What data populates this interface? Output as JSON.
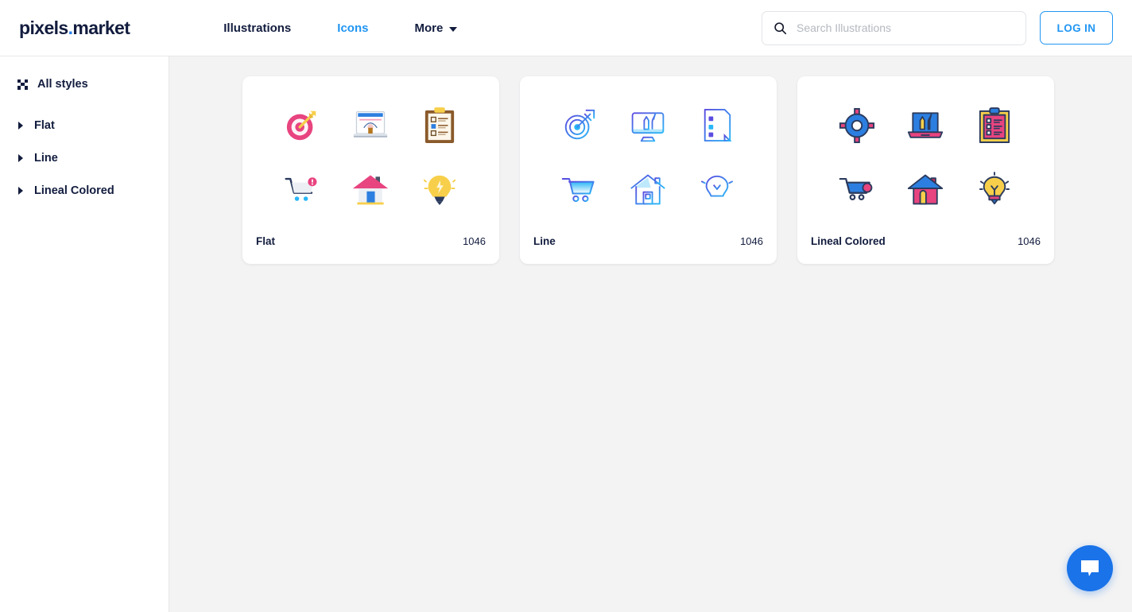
{
  "header": {
    "logo": {
      "text_main": "p",
      "text_i": "i",
      "text_rest": "xels",
      "dot": ".",
      "text_market": "market",
      "full": "pixels.market"
    },
    "nav": [
      {
        "label": "Illustrations",
        "active": false,
        "icon": null
      },
      {
        "label": "Icons",
        "active": true,
        "icon": null
      },
      {
        "label": "More",
        "active": false,
        "icon": "chevron-down-icon"
      }
    ],
    "search": {
      "placeholder": "Search Illustrations",
      "value": "",
      "icon": "search-icon"
    },
    "login_label": "LOG IN"
  },
  "sidebar": {
    "items": [
      {
        "label": "All styles",
        "icon": "grid-icon",
        "expandable": false
      },
      {
        "label": "Flat",
        "icon": "caret-right-icon",
        "expandable": true
      },
      {
        "label": "Line",
        "icon": "caret-right-icon",
        "expandable": true
      },
      {
        "label": "Lineal Colored",
        "icon": "caret-right-icon",
        "expandable": true
      }
    ]
  },
  "main": {
    "cards": [
      {
        "title": "Flat",
        "count": "1046",
        "style": "flat",
        "icons": [
          "target-arrow-icon",
          "laptop-design-icon",
          "clipboard-checklist-icon",
          "shopping-cart-badge-icon",
          "house-icon",
          "lightbulb-icon"
        ]
      },
      {
        "title": "Line",
        "count": "1046",
        "style": "line",
        "icons": [
          "target-arrow-icon",
          "monitor-design-icon",
          "checklist-document-icon",
          "shopping-cart-icon",
          "house-icon",
          "lightbulb-icon"
        ]
      },
      {
        "title": "Lineal Colored",
        "count": "1046",
        "style": "lineal-colored",
        "icons": [
          "target-icon",
          "laptop-tools-icon",
          "clipboard-checklist-icon",
          "shopping-cart-badge-icon",
          "house-icon",
          "lightbulb-icon"
        ]
      }
    ]
  },
  "chat": {
    "icon": "chat-bubble-icon",
    "label": ""
  },
  "colors": {
    "accent_blue": "#2196f3",
    "brand_navy": "#121c3e",
    "page_bg": "#f3f3f3",
    "card_bg": "#ffffff",
    "flat_pink": "#e8447f",
    "flat_yellow": "#f7cf4a",
    "line_purple": "#5b4ce0",
    "line_cyan": "#29b6f6",
    "chat_blue": "#1a73e8"
  }
}
